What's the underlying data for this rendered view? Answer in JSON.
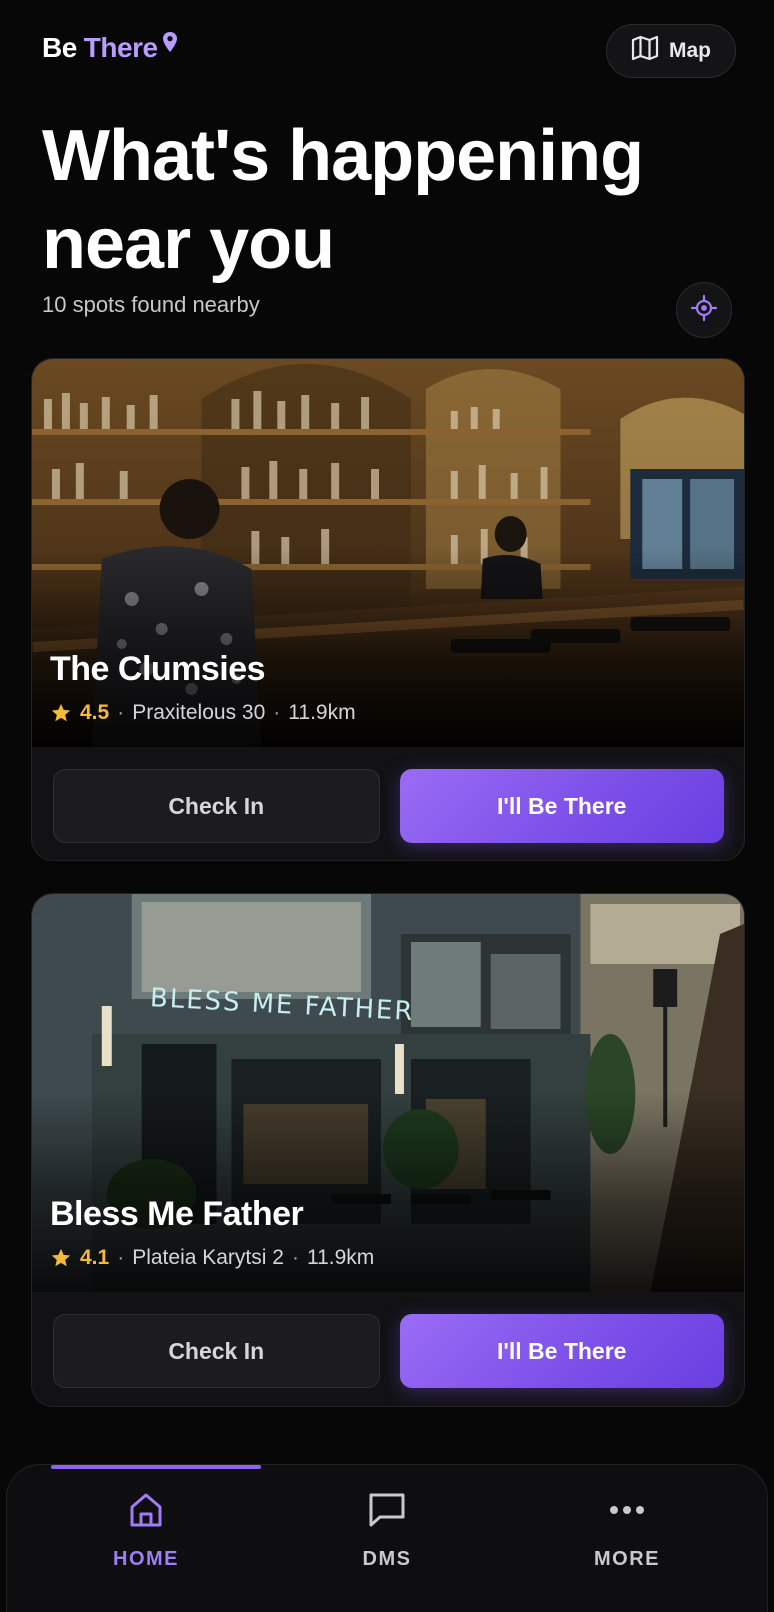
{
  "brand": {
    "part1": "Be",
    "part2": "There",
    "accent": "#b89cff",
    "icon": "location-pin-icon"
  },
  "header": {
    "map_label": "Map",
    "map_icon": "map-icon"
  },
  "hero": {
    "title_line1": "What's happening",
    "title_line2": "near you",
    "subtitle": "10 spots found nearby"
  },
  "venues": [
    {
      "name": "The Clumsies",
      "rating": "4.5",
      "address": "Praxitelous 30",
      "distance": "11.9km",
      "check_in_label": "Check In",
      "be_there_label": "I'll Be There"
    },
    {
      "name": "Bless Me Father",
      "rating": "4.1",
      "address": "Plateia Karytsi 2",
      "distance": "11.9km",
      "check_in_label": "Check In",
      "be_there_label": "I'll Be There",
      "sign_text": "BLESS ME FATHER"
    }
  ],
  "nav": {
    "items": [
      {
        "label": "HOME",
        "icon": "home-icon",
        "active": true
      },
      {
        "label": "DMS",
        "icon": "chat-icon",
        "active": false
      },
      {
        "label": "MORE",
        "icon": "more-icon",
        "active": false
      }
    ]
  },
  "colors": {
    "background": "#070708",
    "primary": "#7b4ee8",
    "rating": "#f5b93a",
    "active_nav": "#a07cf6"
  }
}
